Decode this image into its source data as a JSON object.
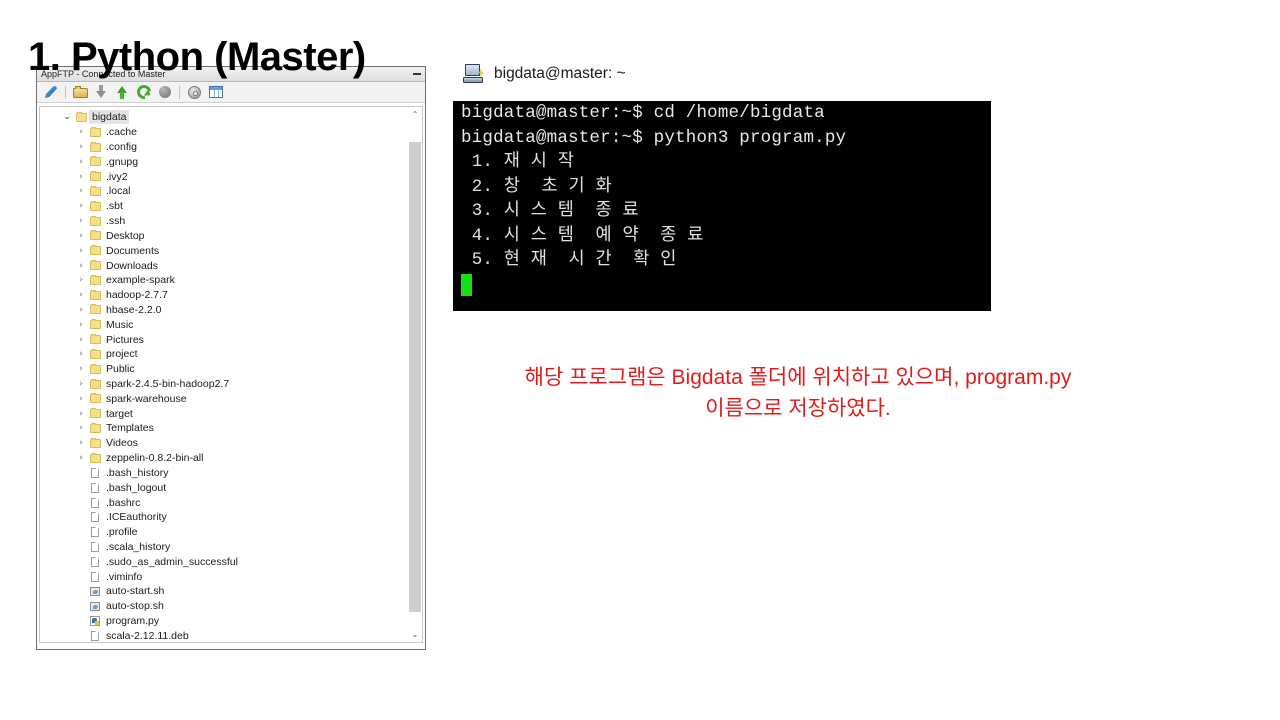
{
  "slide": {
    "title": "1. Python (Master)"
  },
  "file_manager": {
    "window_title": "AppFTP - Connected to Master",
    "minimize_label": "_",
    "toolbar": [
      {
        "name": "edit-feather-icon",
        "label": "Edit"
      },
      {
        "name": "separator-1",
        "label": ""
      },
      {
        "name": "upload-folder-icon",
        "label": "Upload"
      },
      {
        "name": "download-icon",
        "label": "Download"
      },
      {
        "name": "upload-arrow-icon",
        "label": "Upload arrow"
      },
      {
        "name": "refresh-icon",
        "label": "Refresh"
      },
      {
        "name": "stop-icon",
        "label": "Stop"
      },
      {
        "name": "separator-2",
        "label": ""
      },
      {
        "name": "settings-gear-icon",
        "label": "Settings"
      },
      {
        "name": "grid-view-icon",
        "label": "Grid view"
      }
    ],
    "tree": [
      {
        "label": "bigdata",
        "icon": "folder",
        "level": 0,
        "twisty": "open",
        "selected": true
      },
      {
        "label": ".cache",
        "icon": "folder",
        "level": 1,
        "twisty": "closed",
        "selected": false
      },
      {
        "label": ".config",
        "icon": "folder",
        "level": 1,
        "twisty": "closed",
        "selected": false
      },
      {
        "label": ".gnupg",
        "icon": "folder",
        "level": 1,
        "twisty": "closed",
        "selected": false
      },
      {
        "label": ".ivy2",
        "icon": "folder",
        "level": 1,
        "twisty": "closed",
        "selected": false
      },
      {
        "label": ".local",
        "icon": "folder",
        "level": 1,
        "twisty": "closed",
        "selected": false
      },
      {
        "label": ".sbt",
        "icon": "folder",
        "level": 1,
        "twisty": "closed",
        "selected": false
      },
      {
        "label": ".ssh",
        "icon": "folder",
        "level": 1,
        "twisty": "closed",
        "selected": false
      },
      {
        "label": "Desktop",
        "icon": "folder",
        "level": 1,
        "twisty": "closed",
        "selected": false
      },
      {
        "label": "Documents",
        "icon": "folder",
        "level": 1,
        "twisty": "closed",
        "selected": false
      },
      {
        "label": "Downloads",
        "icon": "folder",
        "level": 1,
        "twisty": "closed",
        "selected": false
      },
      {
        "label": "example-spark",
        "icon": "folder",
        "level": 1,
        "twisty": "closed",
        "selected": false
      },
      {
        "label": "hadoop-2.7.7",
        "icon": "folder",
        "level": 1,
        "twisty": "closed",
        "selected": false
      },
      {
        "label": "hbase-2.2.0",
        "icon": "folder",
        "level": 1,
        "twisty": "closed",
        "selected": false
      },
      {
        "label": "Music",
        "icon": "folder",
        "level": 1,
        "twisty": "closed",
        "selected": false
      },
      {
        "label": "Pictures",
        "icon": "folder",
        "level": 1,
        "twisty": "closed",
        "selected": false
      },
      {
        "label": "project",
        "icon": "folder",
        "level": 1,
        "twisty": "closed",
        "selected": false
      },
      {
        "label": "Public",
        "icon": "folder",
        "level": 1,
        "twisty": "closed",
        "selected": false
      },
      {
        "label": "spark-2.4.5-bin-hadoop2.7",
        "icon": "folder",
        "level": 1,
        "twisty": "closed",
        "selected": false
      },
      {
        "label": "spark-warehouse",
        "icon": "folder",
        "level": 1,
        "twisty": "closed",
        "selected": false
      },
      {
        "label": "target",
        "icon": "folder",
        "level": 1,
        "twisty": "closed",
        "selected": false
      },
      {
        "label": "Templates",
        "icon": "folder",
        "level": 1,
        "twisty": "closed",
        "selected": false
      },
      {
        "label": "Videos",
        "icon": "folder",
        "level": 1,
        "twisty": "closed",
        "selected": false
      },
      {
        "label": "zeppelin-0.8.2-bin-all",
        "icon": "folder",
        "level": 1,
        "twisty": "closed",
        "selected": false
      },
      {
        "label": ".bash_history",
        "icon": "file",
        "level": 1,
        "twisty": "none",
        "selected": false
      },
      {
        "label": ".bash_logout",
        "icon": "file",
        "level": 1,
        "twisty": "none",
        "selected": false
      },
      {
        "label": ".bashrc",
        "icon": "file",
        "level": 1,
        "twisty": "none",
        "selected": false
      },
      {
        "label": ".ICEauthority",
        "icon": "file",
        "level": 1,
        "twisty": "none",
        "selected": false
      },
      {
        "label": ".profile",
        "icon": "file",
        "level": 1,
        "twisty": "none",
        "selected": false
      },
      {
        "label": ".scala_history",
        "icon": "file",
        "level": 1,
        "twisty": "none",
        "selected": false
      },
      {
        "label": ".sudo_as_admin_successful",
        "icon": "file",
        "level": 1,
        "twisty": "none",
        "selected": false
      },
      {
        "label": ".viminfo",
        "icon": "file",
        "level": 1,
        "twisty": "none",
        "selected": false
      },
      {
        "label": "auto-start.sh",
        "icon": "shell",
        "level": 1,
        "twisty": "none",
        "selected": false
      },
      {
        "label": "auto-stop.sh",
        "icon": "shell",
        "level": 1,
        "twisty": "none",
        "selected": false
      },
      {
        "label": "program.py",
        "icon": "python",
        "level": 1,
        "twisty": "none",
        "selected": false
      },
      {
        "label": "scala-2.12.11.deb",
        "icon": "file",
        "level": 1,
        "twisty": "none",
        "selected": false
      }
    ],
    "scrollbar": {
      "up_arrow": "⌃",
      "down_arrow": "⌄"
    }
  },
  "terminal": {
    "title": "bigdata@master: ~",
    "lines": [
      "bigdata@master:~$ cd /home/bigdata",
      "bigdata@master:~$ python3 program.py",
      " 1. 재 시 작",
      " 2. 창  초 기 화",
      " 3. 시 스 템  종 료",
      " 4. 시 스 템  예 약  종 료",
      " 5. 현 재  시 간  확 인"
    ],
    "cursor_color": "#16e016",
    "background_color": "#000000",
    "text_color": "#e8e8e8"
  },
  "caption": {
    "line1": "해당 프로그램은 Bigdata 폴더에 위치하고 있으며, program.py",
    "line2": "이름으로 저장하였다.",
    "color": "#e01b1b"
  }
}
